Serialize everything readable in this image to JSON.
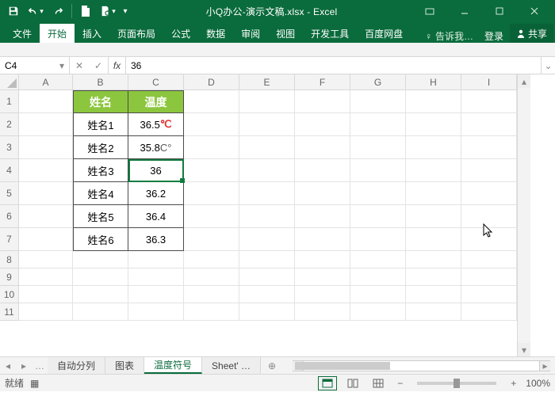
{
  "app": {
    "title": "小Q办公-演示文稿.xlsx - Excel"
  },
  "ribbon": {
    "tabs": [
      "文件",
      "开始",
      "插入",
      "页面布局",
      "公式",
      "数据",
      "审阅",
      "视图",
      "开发工具",
      "百度网盘"
    ],
    "active_index": 1,
    "tellme": "♀ 告诉我…",
    "signin": "登录",
    "share": "共享"
  },
  "formula_bar": {
    "name_box": "C4",
    "fx": "fx",
    "value": "36"
  },
  "columns": [
    "A",
    "B",
    "C",
    "D",
    "E",
    "F",
    "G",
    "H",
    "I"
  ],
  "rows": [
    "1",
    "2",
    "3",
    "4",
    "5",
    "6",
    "7",
    "8",
    "9",
    "10",
    "11"
  ],
  "table": {
    "headers": [
      "姓名",
      "温度"
    ],
    "rows": [
      {
        "name": "姓名1",
        "temp": "36.5",
        "unit": "℃",
        "unit_style": "red"
      },
      {
        "name": "姓名2",
        "temp": "35.8",
        "unit": "C°",
        "unit_style": "dark"
      },
      {
        "name": "姓名3",
        "temp": "36",
        "unit": "",
        "unit_style": ""
      },
      {
        "name": "姓名4",
        "temp": "36.2",
        "unit": "",
        "unit_style": ""
      },
      {
        "name": "姓名5",
        "temp": "36.4",
        "unit": "",
        "unit_style": ""
      },
      {
        "name": "姓名6",
        "temp": "36.3",
        "unit": "",
        "unit_style": ""
      }
    ]
  },
  "sheets": {
    "tabs": [
      "自动分列",
      "图表",
      "温度符号",
      "Sheet' …"
    ],
    "active_index": 2,
    "ellipsis": "…"
  },
  "status": {
    "text": "就绪",
    "macro_icon": "▦",
    "zoom": "100%"
  }
}
